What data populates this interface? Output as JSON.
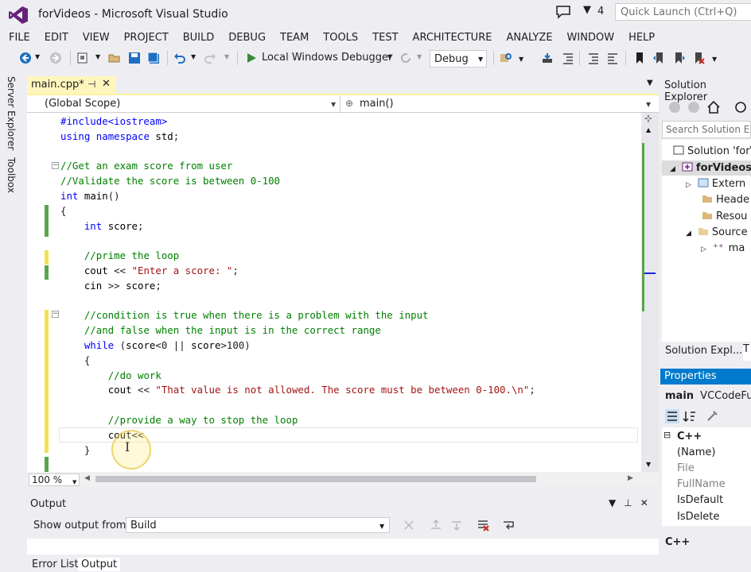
{
  "window": {
    "title": "forVideos - Microsoft Visual Studio",
    "notifications_count": "4",
    "quick_launch_placeholder": "Quick Launch (Ctrl+Q)"
  },
  "menu": [
    "FILE",
    "EDIT",
    "VIEW",
    "PROJECT",
    "BUILD",
    "DEBUG",
    "TEAM",
    "TOOLS",
    "TEST",
    "ARCHITECTURE",
    "ANALYZE",
    "WINDOW",
    "HELP"
  ],
  "toolbar": {
    "debugger_label": "Local Windows Debugger",
    "configuration": "Debug"
  },
  "side_tabs": [
    "Server Explorer",
    "Toolbox"
  ],
  "editor": {
    "tab_label": "main.cpp*",
    "scope_left": "(Global Scope)",
    "scope_right": "main()",
    "zoom": "100 %",
    "lines": [
      "#include<iostream>",
      "using namespace std;",
      "",
      "//Get an exam score from user",
      "//Validate the score is between 0-100",
      "int main()",
      "{",
      "    int score;",
      "",
      "    //prime the loop",
      "    cout << \"Enter a score: \";",
      "    cin >> score;",
      "",
      "    //condition is true when there is a problem with the input",
      "    //and false when the input is in the correct range",
      "    while (score<0 || score>100)",
      "    {",
      "        //do work",
      "        cout << \"That value is not allowed. The score must be between 0-100.\\n\";",
      "",
      "        //provide a way to stop the loop",
      "        cout<<",
      "    }"
    ]
  },
  "output": {
    "title": "Output",
    "show_label": "Show output from:",
    "source": "Build",
    "tabs": [
      "Error List",
      "Output"
    ]
  },
  "solution_explorer": {
    "title": "Solution Explorer",
    "search_placeholder": "Search Solution Ex",
    "tree": [
      "Solution 'forV",
      "forVideos",
      "Extern",
      "Heade",
      "Resou",
      "Source",
      "ma"
    ],
    "tabs": [
      "Solution Expl...",
      "T"
    ]
  },
  "properties": {
    "title": "Properties",
    "object": "main",
    "object_type": "VCCodeFunc",
    "category": "C++",
    "rows": [
      "(Name)",
      "File",
      "FullName",
      "IsDefault",
      "IsDelete"
    ],
    "description": "C++"
  },
  "colors": {
    "accent": "#007acc",
    "keyword": "#0000ff",
    "comment": "#008000",
    "string": "#a31515",
    "tab_modified": "#fff6be"
  }
}
